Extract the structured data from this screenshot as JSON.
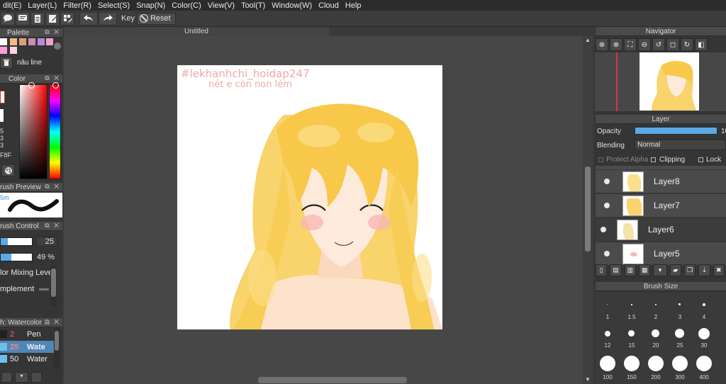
{
  "menu": [
    "dit(E)",
    "Layer(L)",
    "Filter(R)",
    "Select(S)",
    "Snap(N)",
    "Color(C)",
    "View(V)",
    "Tool(T)",
    "Window(W)",
    "Cloud",
    "Help"
  ],
  "toolbar": {
    "key_label": "Key",
    "reset_label": "Reset"
  },
  "palette": {
    "title": "Palette",
    "swatches": [
      "#ffffff",
      "#f7b888",
      "#d9a07a",
      "#c98fb0",
      "#b38bd6",
      "#f0a0d0",
      "#ff9fd8",
      "#ffd0e8",
      "#bfe8ff",
      "#b4dcf6",
      "#f7c896",
      "#f4b183"
    ],
    "selected_name": "nâu line"
  },
  "color": {
    "title": "Color",
    "rgb_partial": [
      "5",
      "3",
      "3"
    ],
    "hex_partial": "F8F"
  },
  "brush_preview": {
    "title": "rush Preview",
    "size_text": "5m"
  },
  "brush_control": {
    "title": "rush Control",
    "size_value": "25",
    "density_value": "49 %",
    "size_level": 0.22,
    "density_level": 0.35,
    "mixing_label": "lor Mixing Leve",
    "supplement_label": "mplement"
  },
  "brush_list": {
    "title": "h: Watercolor ...",
    "items": [
      {
        "size": "2",
        "name": "Pen",
        "size_color": "#e07070",
        "color": "#3a3a3a"
      },
      {
        "size": "25",
        "name": "Wate",
        "size_color": "#e07070",
        "color": "#6cc0f0"
      },
      {
        "size": "50",
        "name": "Water",
        "size_color": "#eeeeee",
        "color": "#6cc0f0"
      }
    ]
  },
  "canvas": {
    "tab_title": "Untitled",
    "watermark_line1": "#lekhanhchi_hoidap247",
    "watermark_line2": "nét e còn non lém"
  },
  "navigator": {
    "title": "Navigator"
  },
  "layer_panel": {
    "title": "Layer",
    "opacity_label": "Opacity",
    "opacity_value": "10",
    "blending_label": "Blending",
    "blending_value": "Normal",
    "protect_alpha_label": "Protect Alpha",
    "clipping_label": "Clipping",
    "lock_label": "Lock",
    "layers": [
      {
        "name": "Layer8",
        "selected": false
      },
      {
        "name": "Layer7",
        "selected": false
      },
      {
        "name": "Layer6",
        "selected": true
      },
      {
        "name": "Layer5",
        "selected": false
      }
    ]
  },
  "brush_size": {
    "title": "Brush Size",
    "sizes": [
      "1",
      "1.5",
      "2",
      "3",
      "4",
      "12",
      "15",
      "20",
      "25",
      "30",
      "100",
      "150",
      "200",
      "300",
      "400"
    ]
  },
  "colors": {
    "accent_blue": "#5aa9e6",
    "watermark_pink": "#f2a7a7",
    "hair_yellow": "#f7c84a",
    "skin": "#fde3cc"
  }
}
